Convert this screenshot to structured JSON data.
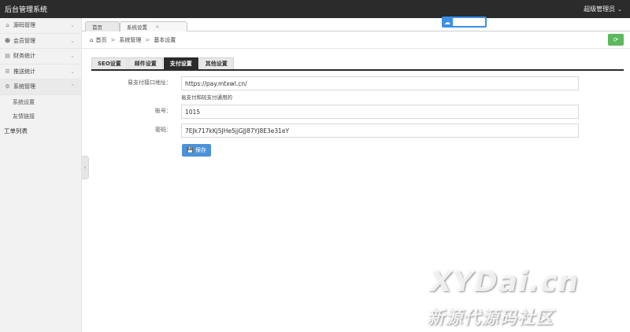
{
  "app": {
    "title": "后台管理系统",
    "user": "超级管理员"
  },
  "sidebar": {
    "items": [
      {
        "label": "源码管理",
        "icon": "home-icon"
      },
      {
        "label": "会员管理",
        "icon": "user-icon"
      },
      {
        "label": "财务统计",
        "icon": "chart-icon"
      },
      {
        "label": "推送统计",
        "icon": "list-icon"
      },
      {
        "label": "系统管理",
        "icon": "gear-icon"
      }
    ],
    "sub_items": [
      "系统设置",
      "友情链接"
    ],
    "extra": "工单列表"
  },
  "tabs": [
    {
      "label": "首页"
    },
    {
      "label": "系统设置"
    }
  ],
  "breadcrumb": [
    "首页",
    "系统管理",
    "基本设置"
  ],
  "settings_tabs": [
    "SEO设置",
    "邮件设置",
    "支付设置",
    "其他设置"
  ],
  "form": {
    "api_label": "易支付接口地址：",
    "api_value": "https://pay.mtxwl.cn/",
    "api_help": "易支付和码支付通用的",
    "account_label": "账号：",
    "account_value": "1015",
    "password_label": "密码：",
    "password_value": "7EJk717kKj5JHe5jjGJJ87YJ8E3e31eY",
    "save_label": "保存"
  },
  "watermark": {
    "main": "XYDai.cn",
    "sub": "新源代源码社区"
  },
  "colors": {
    "topbar": "#2b2b2b",
    "refresh": "#5cb85c",
    "save": "#4c92d9",
    "tab_active": "#2b2b2b"
  }
}
